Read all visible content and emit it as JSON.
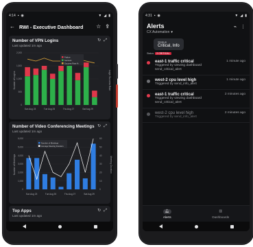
{
  "left": {
    "status": {
      "time": "4:14"
    },
    "appbar": {
      "title": "RWI - Executive Dashboard",
      "back_icon": "arrow-left-icon",
      "star_icon": "star-outline-icon",
      "share_icon": "share-icon"
    },
    "card_vpn": {
      "title": "Number of VPN Logins",
      "subtitle": "Last updated 1m ago",
      "ylabel": "Number of Logins",
      "y2label": "Login Success Rate",
      "legend": [
        "Failure",
        "Success",
        "Success Rate %"
      ]
    },
    "card_video": {
      "title": "Number of Video Conferencing Meetings",
      "subtitle": "Last updated 1m ago",
      "ylabel": "Number of Meetings",
      "y2label": "Meeting Duration",
      "legend": [
        "Number of Meetings",
        "Average Meeting Duration"
      ]
    },
    "card_apps": {
      "title": "Top Apps",
      "subtitle": "Last updated 1m ago"
    }
  },
  "chart_data": [
    {
      "type": "bar",
      "title": "Number of VPN Logins",
      "xlabel": "",
      "ylabel": "Number of Logins",
      "categories": [
        "Sun Aug 23",
        "Tue Aug 25",
        "Thu Aug 27",
        "Sat Aug 29"
      ],
      "bars_x": [
        1,
        2,
        3,
        4,
        5,
        6,
        7,
        8,
        9
      ],
      "series": [
        {
          "name": "Success",
          "values": [
            1100,
            1150,
            1350,
            1000,
            1300,
            1500,
            950,
            1450,
            300
          ],
          "color": "#2db04a"
        },
        {
          "name": "Failure",
          "values": [
            350,
            250,
            150,
            200,
            200,
            0,
            280,
            180,
            250
          ],
          "color": "#e0384b"
        },
        {
          "name": "Success Rate %",
          "values": [
            1.2,
            1.0,
            1.3,
            1.0,
            1.0,
            0.9,
            1.2,
            1.0,
            0.8
          ],
          "color": "#e2a83a"
        }
      ],
      "ylim": [
        0,
        2000
      ],
      "y_ticks": [
        "0",
        "500",
        "1,000",
        "1,500",
        "2,000"
      ]
    },
    {
      "type": "bar",
      "title": "Number of Video Conferencing Meetings",
      "xlabel": "",
      "ylabel": "Number of Meetings",
      "categories": [
        "Sun Aug 23",
        "Tue Aug 25",
        "Thu Aug 27",
        "Sat Aug 29"
      ],
      "bars_x": [
        1,
        2,
        3,
        4,
        5,
        6,
        7,
        8,
        9
      ],
      "series": [
        {
          "name": "Number of Meetings",
          "values": [
            3700,
            3700,
            1800,
            1400,
            300,
            1900,
            3500,
            1300,
            5400
          ],
          "color": "#2f7de1"
        },
        {
          "name": "Average Meeting Duration",
          "values": [
            40,
            12,
            45,
            20,
            15,
            30,
            55,
            20,
            60
          ],
          "color": "#ffffff"
        }
      ],
      "ylim": [
        0,
        6000
      ],
      "y_ticks": [
        "0",
        "1,000",
        "2,000",
        "3,000",
        "4,000",
        "5,000",
        "6,000"
      ],
      "y2_ticks": [
        "0",
        "10",
        "20",
        "30",
        "40",
        "50",
        "60"
      ]
    }
  ],
  "right": {
    "status": {
      "time": "4:31"
    },
    "header": {
      "title": "Alerts",
      "subtitle": "CX Automation"
    },
    "status_chip": {
      "key": "Status",
      "value": "Critical, Info"
    },
    "filter": {
      "label": "Status",
      "tag": "2 CRITICAL"
    },
    "alerts": [
      {
        "name": "east-1 traffic critical",
        "desc1": "Triggered by viewing dashboard",
        "desc2": "send_critical_alert",
        "time": "1 minute ago",
        "color": "#e23b4e",
        "dim": false
      },
      {
        "name": "west-2 cpu level high",
        "desc1": "Triggered by send_info_alert",
        "desc2": "",
        "time": "1 minute ago",
        "color": "#6f7075",
        "dim": false
      },
      {
        "name": "east-1 traffic critical",
        "desc1": "Triggered by viewing dashboard",
        "desc2": "send_critical_alert",
        "time": "2 minutes ago",
        "color": "#e23b4e",
        "dim": false
      },
      {
        "name": "west-2 cpu level high",
        "desc1": "Triggered by send_info_alert",
        "desc2": "",
        "time": "2 minutes ago",
        "color": "#55565a",
        "dim": true
      }
    ],
    "bottom_nav": [
      {
        "label": "Alerts",
        "icon": "bell-icon",
        "active": true
      },
      {
        "label": "Dashboards",
        "icon": "bar-chart-icon",
        "active": false
      }
    ]
  }
}
